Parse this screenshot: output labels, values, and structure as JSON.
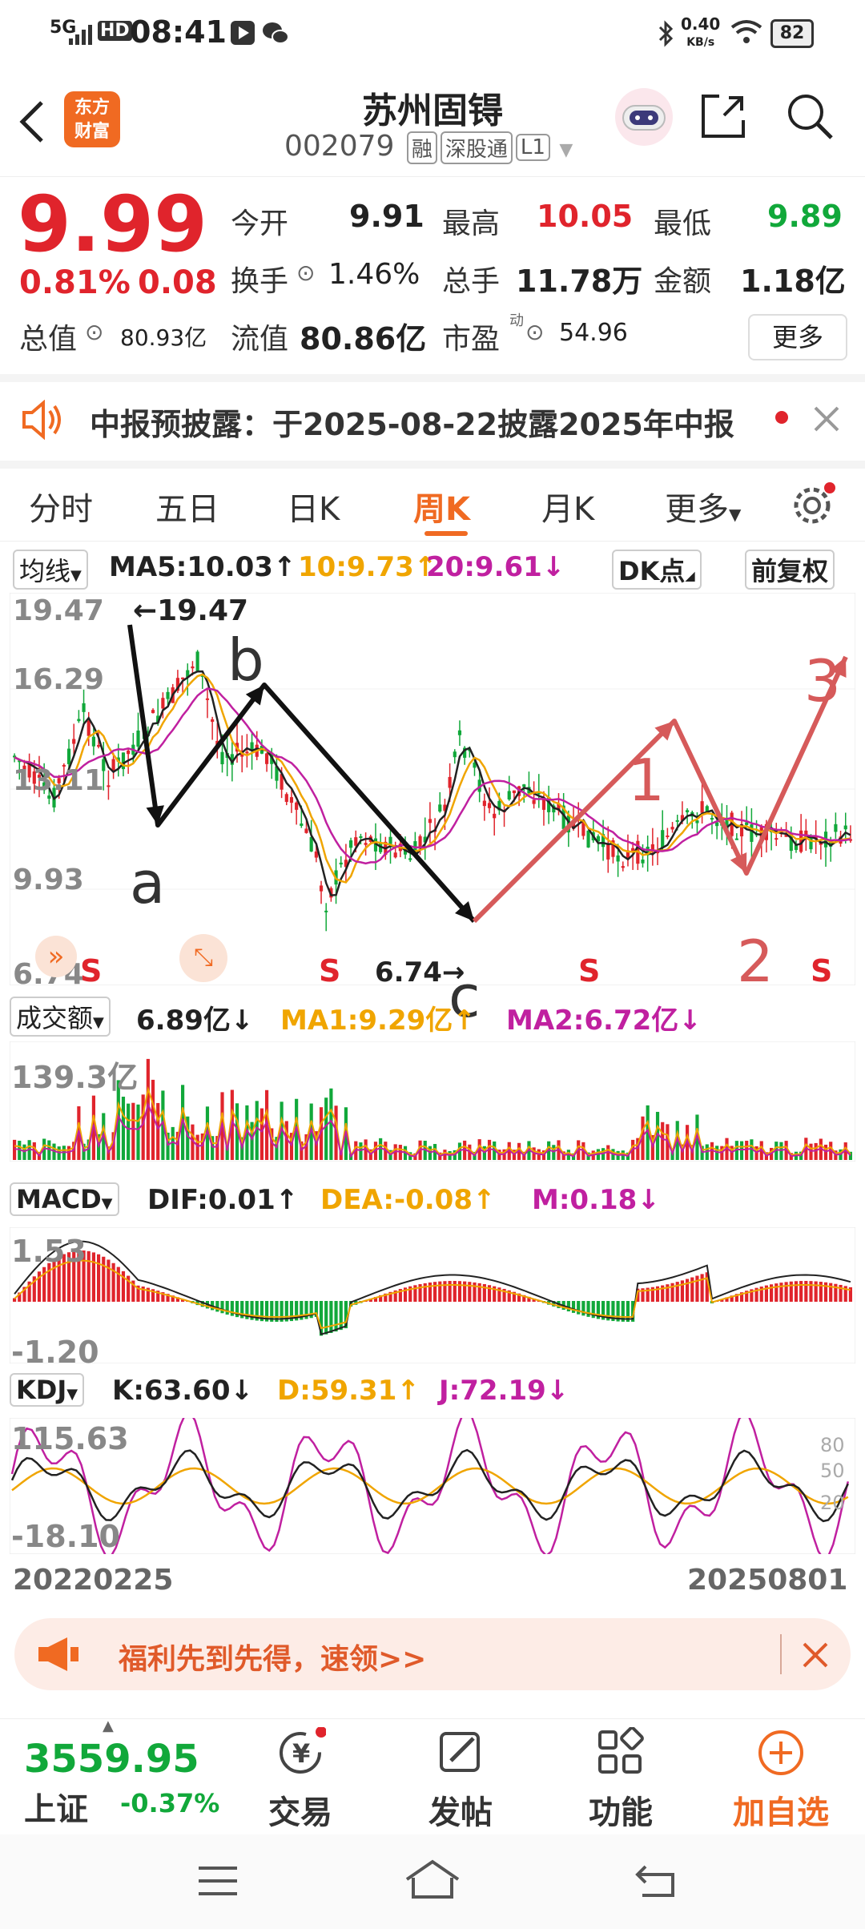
{
  "status": {
    "network": "5G",
    "hd": "HD",
    "time": "08:41",
    "speed": "0.40",
    "speed_unit": "KB/s",
    "battery": "82"
  },
  "header": {
    "logo_line1": "东方",
    "logo_line2": "财富",
    "title": "苏州固锝",
    "code": "002079",
    "tag_rong": "融",
    "tag_sgt": "深股通",
    "tag_level": "L1"
  },
  "quote": {
    "price": "9.99",
    "change_pct": "0.81%",
    "change": "0.08",
    "open_label": "今开",
    "open": "9.91",
    "high_label": "最高",
    "high": "10.05",
    "low_label": "最低",
    "low": "9.89",
    "turnover_label": "换手",
    "turnover": "1.46%",
    "volume_label": "总手",
    "volume": "11.78万",
    "amount_label": "金额",
    "amount": "1.18亿",
    "mktcap_label": "总值",
    "mktcap": "80.93亿",
    "float_label": "流值",
    "float": "80.86亿",
    "pe_label": "市盈",
    "pe_sup": "动",
    "pe": "54.96",
    "more": "更多"
  },
  "notice": {
    "text": "中报预披露：于2025-08-22披露2025年中报"
  },
  "tabs": [
    "分时",
    "五日",
    "日K",
    "周K",
    "月K",
    "更多"
  ],
  "ma_bar": {
    "selector": "均线",
    "ma5": "MA5:10.03↑",
    "ma10": "10:9.73↑",
    "ma20": "20:9.61↓",
    "dk": "DK点",
    "adjust": "前复权"
  },
  "kline": {
    "y_labels": [
      "19.47",
      "16.29",
      "13.11",
      "9.93",
      "6.74"
    ],
    "max_label": "←19.47",
    "min_label": "6.74→",
    "signals": [
      "S",
      "S",
      "S",
      "S"
    ],
    "annotations": [
      "a",
      "b",
      "c",
      "1",
      "2",
      "3"
    ]
  },
  "vol_bar": {
    "selector": "成交额",
    "value": "6.89亿↓",
    "ma1": "MA1:9.29亿↑",
    "ma2": "MA2:6.72亿↓",
    "max_label": "139.3亿"
  },
  "macd_bar": {
    "selector": "MACD",
    "dif": "DIF:0.01↑",
    "dea": "DEA:-0.08↑",
    "m": "M:0.18↓",
    "top_label": "1.53",
    "bottom_label": "-1.20"
  },
  "kdj_bar": {
    "selector": "KDJ",
    "k": "K:63.60↓",
    "d": "D:59.31↑",
    "j": "J:72.19↓",
    "top_label": "115.63",
    "bottom_label": "-18.10",
    "levels": [
      "80",
      "50",
      "20"
    ]
  },
  "dates": {
    "start": "20220225",
    "end": "20250801"
  },
  "promo": {
    "text": "福利先到先得，速领>>"
  },
  "nav": {
    "index_value": "3559.95",
    "index_name": "上证",
    "index_change": "-0.37%",
    "trade": "交易",
    "post": "发帖",
    "func": "功能",
    "add": "加自选"
  },
  "colors": {
    "up": "#e0242c",
    "down": "#11a83a",
    "accent": "#f06a22",
    "ma10": "#f0a500",
    "ma20": "#c020a0"
  }
}
